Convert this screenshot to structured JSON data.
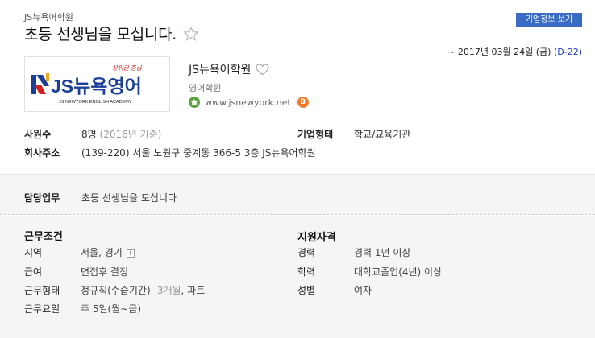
{
  "header": {
    "company_small": "JS뉴욕어학원",
    "job_title": "초등 선생님을 모십니다.",
    "company_info_button": "기업정보 보기"
  },
  "deadline": {
    "prefix": "~ 2017년 03월 24일 (금) ",
    "dday_open": "(",
    "dday": "D-22",
    "dday_close": ")"
  },
  "logo": {
    "main_text": "JS뉴욕영어",
    "sub_text": "JS NEWYORK ENGLISH ACADEMY",
    "slogan": "상위권 중심~"
  },
  "company": {
    "name": "JS뉴욕어학원",
    "type": "영어학원",
    "homepage": "www.jsnewyork.net",
    "blog_badge": "B"
  },
  "company_details": {
    "employees_label": "사원수",
    "employees_value": "8명",
    "employees_note": "(2016년 기준)",
    "corp_type_label": "기업형태",
    "corp_type_value": "학교/교육기관",
    "address_label": "회사주소",
    "address_value": "(139-220) 서울 노원구 중계동 366-5 3층 JS뉴욕어학원"
  },
  "duty": {
    "label": "담당업무",
    "value": "초등 선생님을 모십니다"
  },
  "conditions": {
    "title": "근무조건",
    "rows": [
      {
        "label": "지역",
        "value": "서울, 경기"
      },
      {
        "label": "급여",
        "value": "면접후 결정"
      },
      {
        "label": "근무형태",
        "value": "정규직(수습기간)",
        "note": "-3개월",
        "suffix": ", 파트"
      },
      {
        "label": "근무요일",
        "value": "주 5일(월~금)"
      }
    ]
  },
  "qualifications": {
    "title": "지원자격",
    "rows": [
      {
        "label": "경력",
        "value": "경력 1년 이상"
      },
      {
        "label": "학력",
        "value": "대학교졸업(4년) 이상"
      },
      {
        "label": "성별",
        "value": "여자"
      }
    ]
  },
  "colors": {
    "button_blue": "#3a6cc6",
    "dday_blue": "#1f3fbf",
    "home_green": "#5aa33f",
    "blog_orange": "#f07a2a",
    "section_bg": "#f5f5f5"
  },
  "icons": {
    "star": "star-outline-icon",
    "heart": "heart-outline-icon",
    "home": "home-icon",
    "blog": "blog-icon",
    "expand": "plus-icon"
  }
}
